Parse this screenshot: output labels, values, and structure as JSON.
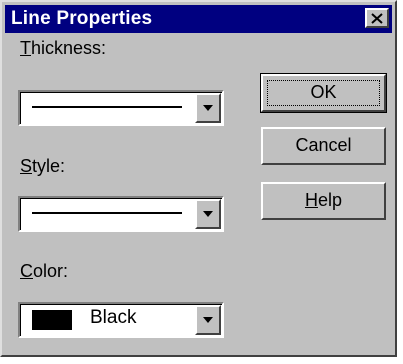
{
  "dialog": {
    "title": "Line Properties"
  },
  "fields": {
    "thickness_label": "Thickness:",
    "style_label": "Style:",
    "color_label": "Color:",
    "color_value": "Black"
  },
  "buttons": {
    "ok": "OK",
    "cancel": "Cancel",
    "help": "Help"
  },
  "icons": {
    "close": "close-icon",
    "dropdown": "chevron-down-icon"
  },
  "colors": {
    "titlebar": "#000080",
    "face": "#c0c0c0",
    "swatch": "#000000"
  }
}
